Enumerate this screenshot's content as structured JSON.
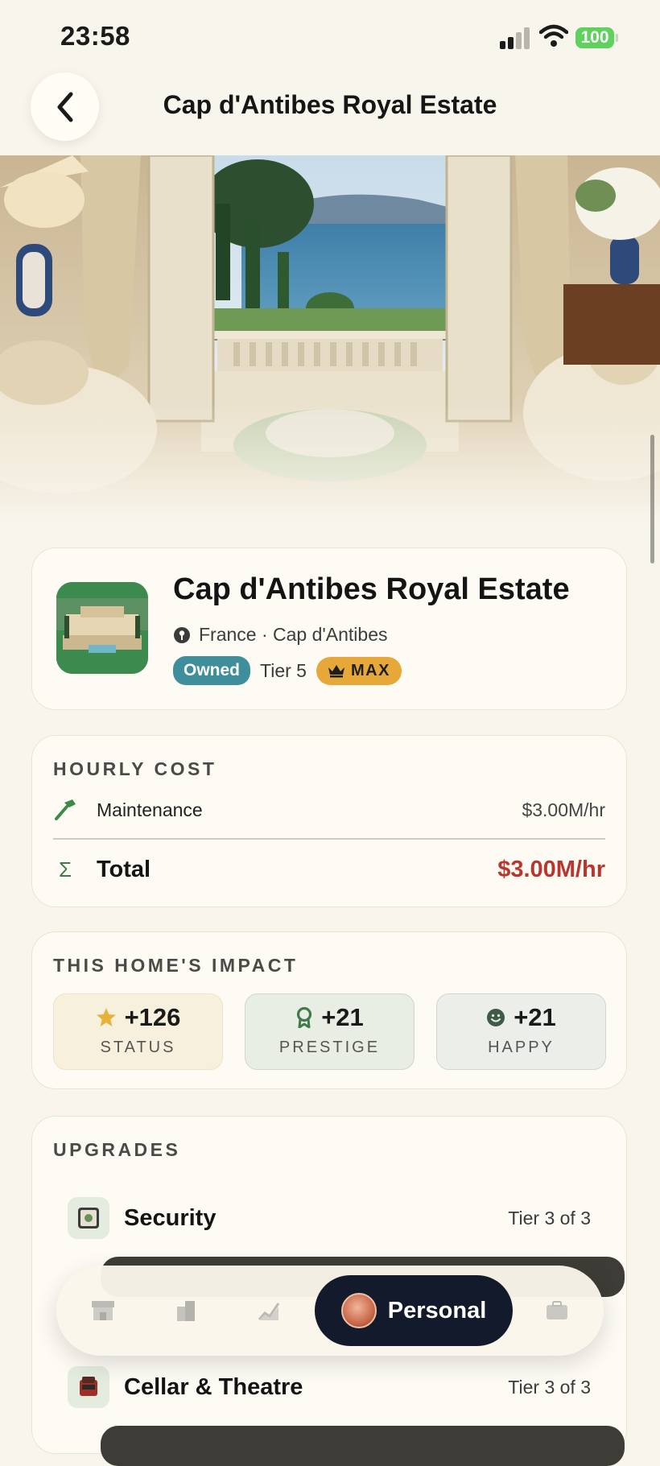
{
  "status_bar": {
    "time": "23:58",
    "battery": "100"
  },
  "header": {
    "title": "Cap d'Antibes Royal Estate"
  },
  "property": {
    "name": "Cap d'Antibes Royal Estate",
    "location": "France · Cap d'Antibes",
    "owned_label": "Owned",
    "tier_label": "Tier 5",
    "max_label": "MAX"
  },
  "hourly_cost": {
    "section_label": "HOURLY COST",
    "items": [
      {
        "label": "Maintenance",
        "value": "$3.00M/hr",
        "icon": "hammer-icon"
      }
    ],
    "total_label": "Total",
    "total_value": "$3.00M/hr",
    "total_icon": "sigma-icon"
  },
  "impact": {
    "section_label": "THIS HOME'S IMPACT",
    "stats": [
      {
        "value": "+126",
        "label": "STATUS",
        "icon": "star-icon",
        "color": "#e7b23c"
      },
      {
        "value": "+21",
        "label": "PRESTIGE",
        "icon": "ribbon-icon",
        "color": "#3f7a4b"
      },
      {
        "value": "+21",
        "label": "HAPPY",
        "icon": "smiley-icon",
        "color": "#3f5a48"
      }
    ]
  },
  "upgrades": {
    "section_label": "UPGRADES",
    "items": [
      {
        "name": "Security",
        "tier": "Tier 3 of 3",
        "icon": "safe-icon"
      },
      {
        "name": "Cellar & Theatre",
        "tier": "Tier 3 of 3",
        "icon": "theatre-icon"
      }
    ]
  },
  "tab_bar": {
    "tabs": [
      {
        "icon": "store-icon"
      },
      {
        "icon": "buildings-icon"
      },
      {
        "icon": "chart-icon"
      },
      {
        "label": "Personal",
        "icon": "avatar-icon",
        "active": true
      },
      {
        "icon": "briefcase-icon"
      }
    ]
  },
  "colors": {
    "accent_teal": "#3f8e9c",
    "max_gold": "#e7a83a",
    "total_red": "#b8362d",
    "tab_active_bg": "#121a2c"
  }
}
